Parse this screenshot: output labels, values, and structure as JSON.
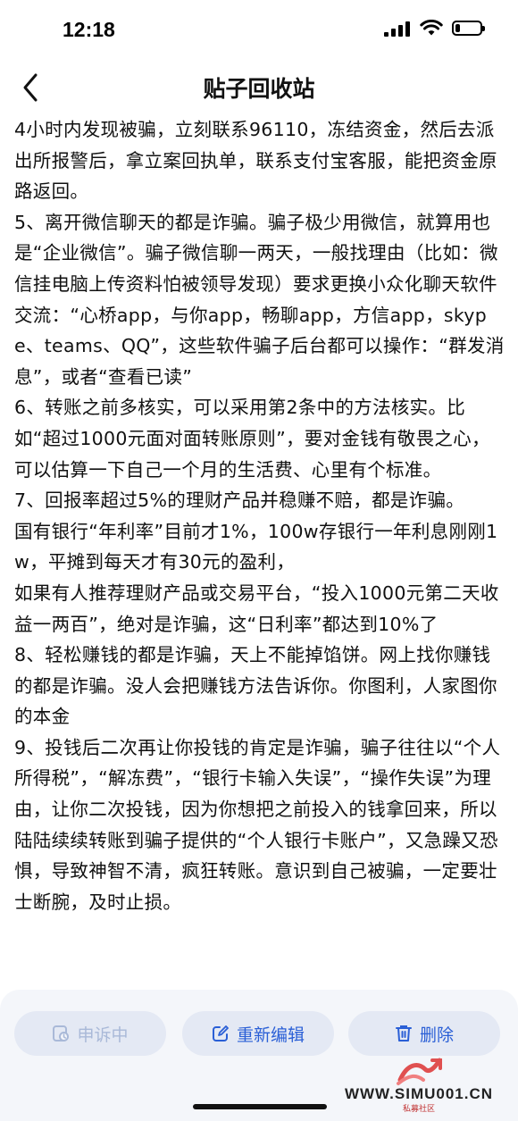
{
  "status_bar": {
    "time": "12:18",
    "icons": [
      "signal-icon",
      "wifi-icon",
      "battery-icon"
    ],
    "battery_level": 0.2
  },
  "nav": {
    "back_icon": "chevron-left-icon",
    "title": "贴子回收站"
  },
  "content": {
    "paragraphs": [
      "4小时内发现被骗，立刻联系96110，冻结资金，然后去派出所报警后，拿立案回执单，联系支付宝客服，能把资金原路返回。",
      "5、离开微信聊天的都是诈骗。骗子极少用微信，就算用也是“企业微信”。骗子微信聊一两天，一般找理由（比如：微信挂电脑上传资料怕被领导发现）要求更换小众化聊天软件交流：“心桥app，与你app，畅聊app，方信app，skype、teams、QQ”，这些软件骗子后台都可以操作：“群发消息”，或者“查看已读”",
      "6、转账之前多核实，可以采用第2条中的方法核实。比如“超过1000元面对面转账原则”，要对金钱有敬畏之心，可以估算一下自己一个月的生活费、心里有个标准。",
      "7、回报率超过5%的理财产品并稳赚不赔，都是诈骗。",
      "国有银行“年利率”目前才1%，100w存银行一年利息刚刚1w，平摊到每天才有30元的盈利，",
      "如果有人推荐理财产品或交易平台，“投入1000元第二天收益一两百”，绝对是诈骗，这“日利率”都达到10%了",
      "8、轻松赚钱的都是诈骗，天上不能掉馅饼。网上找你赚钱的都是诈骗。没人会把赚钱方法告诉你。你图利，人家图你的本金",
      "9、投钱后二次再让你投钱的肯定是诈骗，骗子往往以“个人所得税”，“解冻费”，“银行卡输入失误”，“操作失误”为理由，让你二次投钱，因为你想把之前投入的钱拿回来，所以陆陆续续转账到骗子提供的“个人银行卡账户”，又急躁又恐惧，导致神智不清，疯狂转账。意识到自己被骗，一定要壮士断腕，及时止损。"
    ]
  },
  "actions": {
    "appeal": {
      "label": "申诉中",
      "icon": "appeal-icon",
      "enabled": false
    },
    "reedit": {
      "label": "重新编辑",
      "icon": "edit-icon"
    },
    "delete": {
      "label": "删除",
      "icon": "trash-icon"
    }
  },
  "watermark": {
    "url": "WWW.SIMU001.CN",
    "sub": "私募社区"
  },
  "colors": {
    "accent": "#2a5fd6",
    "disabled": "#a9b9d8",
    "button_bg": "#e4e9f4",
    "bar_bg": "#f4f6fa"
  }
}
